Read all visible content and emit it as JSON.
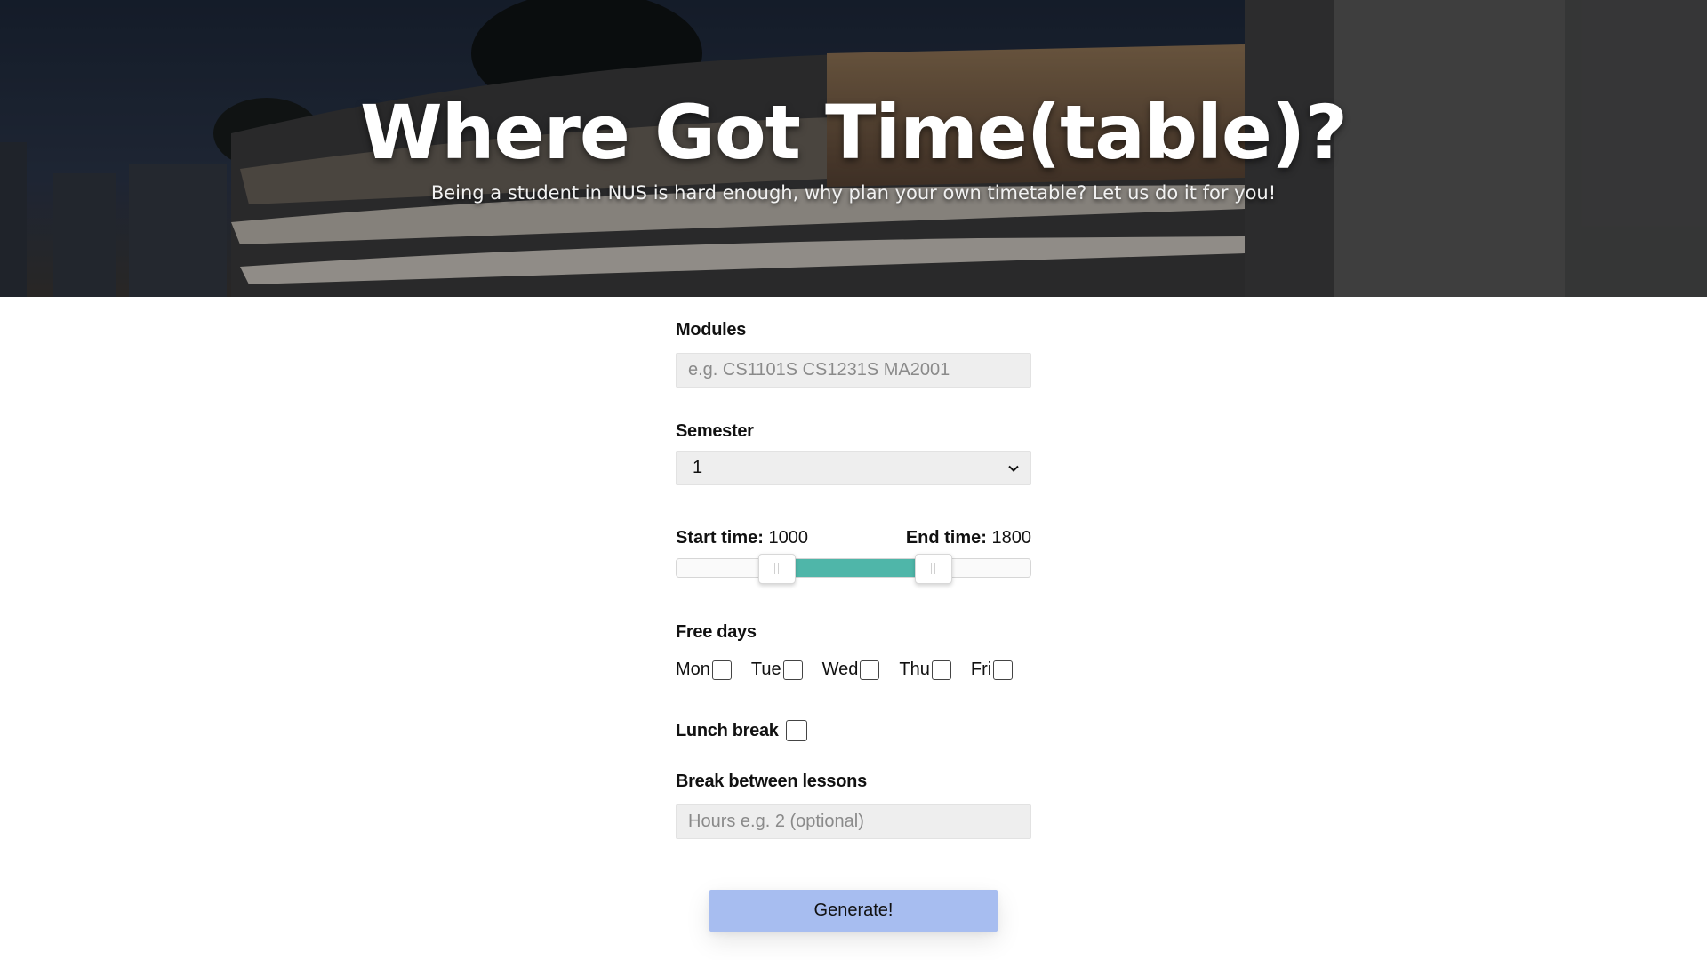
{
  "hero": {
    "title": "Where Got Time(table)?",
    "subtitle": "Being a student in NUS is hard enough, why plan your own timetable? Let us do it for you!"
  },
  "form": {
    "modules": {
      "label": "Modules",
      "value": "",
      "placeholder": "e.g. CS1101S CS1231S MA2001"
    },
    "semester": {
      "label": "Semester",
      "selected": "1"
    },
    "time": {
      "start_label": "Start time:",
      "start_value": "1000",
      "end_label": "End time:",
      "end_value": "1800",
      "range_fraction": [
        0.167,
        0.833
      ]
    },
    "free_days": {
      "label": "Free days",
      "days": [
        {
          "label": "Mon",
          "checked": false
        },
        {
          "label": "Tue",
          "checked": false
        },
        {
          "label": "Wed",
          "checked": false
        },
        {
          "label": "Thu",
          "checked": false
        },
        {
          "label": "Fri",
          "checked": false
        }
      ]
    },
    "lunch_break": {
      "label": "Lunch break",
      "checked": false
    },
    "break_between": {
      "label": "Break between lessons",
      "value": "",
      "placeholder": "Hours e.g. 2 (optional)"
    },
    "generate_label": "Generate!"
  },
  "colors": {
    "accent_teal": "#4fb6a9",
    "button_blue": "#a7bdf0",
    "input_bg": "#eeeeee"
  }
}
